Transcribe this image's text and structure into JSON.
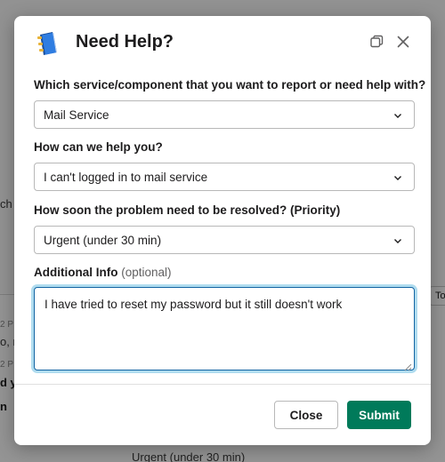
{
  "background": {
    "fragments": [
      "ch",
      "2 P",
      "o, r",
      "2 P",
      "d yo",
      "n",
      "Urgent (under 30 min)"
    ],
    "tab_label": "To"
  },
  "modal": {
    "title": "Need Help?",
    "icons": {
      "app": "notebook-icon",
      "popout": "popout-icon",
      "close": "close-icon"
    },
    "fields": {
      "service": {
        "label": "Which service/component that you want to report or need help with?",
        "value": "Mail Service"
      },
      "help_type": {
        "label": "How can we help you?",
        "value": "I can't logged in to mail service"
      },
      "priority": {
        "label": "How soon the problem need to be resolved? (Priority)",
        "value": "Urgent (under 30 min)"
      },
      "additional_info": {
        "label": "Additional Info",
        "optional_hint": "(optional)",
        "value": "I have tried to reset my password but it still doesn't work"
      }
    },
    "buttons": {
      "close": "Close",
      "submit": "Submit"
    },
    "colors": {
      "primary": "#007a5a",
      "focus": "#1264a3"
    }
  }
}
